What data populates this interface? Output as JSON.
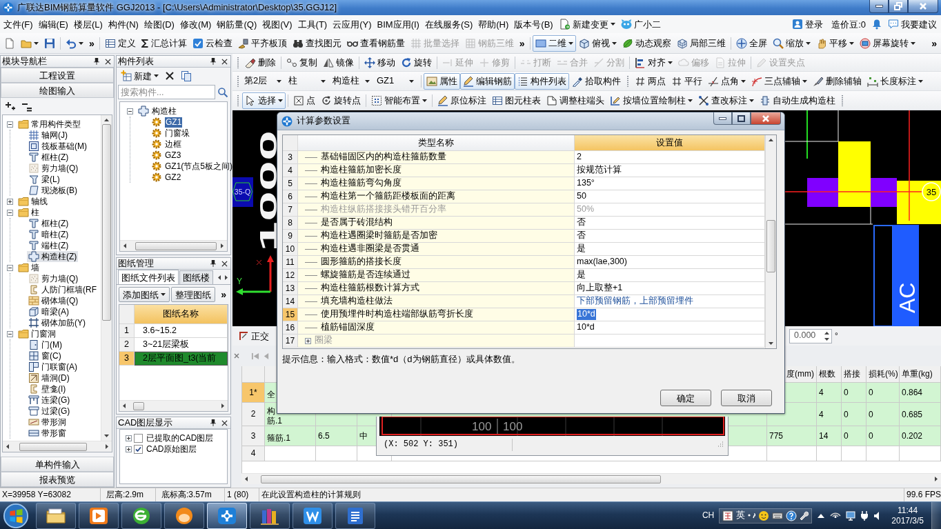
{
  "window": {
    "title": "广联达BIM钢筋算量软件 GGJ2013 - [C:\\Users\\Administrator\\Desktop\\35.GGJ12]"
  },
  "menu_bar": {
    "items": [
      "文件(F)",
      "编辑(E)",
      "楼层(L)",
      "构件(N)",
      "绘图(D)",
      "修改(M)",
      "钢筋量(Q)",
      "视图(V)",
      "工具(T)",
      "云应用(Y)",
      "BIM应用(I)",
      "在线服务(S)",
      "帮助(H)",
      "版本号(B)"
    ],
    "extras": [
      {
        "label": "新建变更",
        "dropdown": true
      },
      {
        "label": "广小二",
        "dropdown": false
      }
    ],
    "account": [
      "登录",
      "造价豆:0",
      "我要建议"
    ]
  },
  "main_toolbar": [
    {
      "kind": "button",
      "dropdown": false,
      "disabled": false,
      "on": false
    },
    {
      "kind": "button",
      "dropdown": true,
      "disabled": false,
      "on": false
    },
    {
      "kind": "button",
      "dropdown": false,
      "disabled": false,
      "on": false
    },
    {
      "kind": "separator"
    },
    {
      "kind": "button",
      "dropdown": true,
      "disabled": false,
      "on": false
    },
    {
      "kind": "overflow",
      "label": "»"
    },
    {
      "kind": "separator"
    },
    {
      "kind": "button",
      "label": "定义",
      "dropdown": false,
      "disabled": false,
      "on": false
    },
    {
      "kind": "button",
      "label": "汇总计算",
      "dropdown": false,
      "disabled": false,
      "on": false
    },
    {
      "kind": "button",
      "label": "云检查",
      "dropdown": false,
      "disabled": false,
      "on": false
    },
    {
      "kind": "button",
      "label": "平齐板顶",
      "dropdown": false,
      "disabled": false,
      "on": false
    },
    {
      "kind": "button",
      "label": "查找图元",
      "dropdown": false,
      "disabled": false,
      "on": false
    },
    {
      "kind": "button",
      "label": "查看钢筋量",
      "dropdown": false,
      "disabled": false,
      "on": false
    },
    {
      "kind": "button",
      "label": "批量选择",
      "dropdown": false,
      "disabled": true,
      "on": false
    },
    {
      "kind": "button",
      "label": "钢筋三维",
      "dropdown": false,
      "disabled": true,
      "on": false
    },
    {
      "kind": "overflow",
      "label": "»"
    },
    {
      "kind": "separator"
    },
    {
      "kind": "button",
      "label": "二维",
      "dropdown": true,
      "disabled": false,
      "on": true
    },
    {
      "kind": "button",
      "label": "俯视",
      "dropdown": true,
      "disabled": false,
      "on": false
    },
    {
      "kind": "button",
      "label": "动态观察",
      "dropdown": false,
      "disabled": false,
      "on": false
    },
    {
      "kind": "button",
      "label": "局部三维",
      "dropdown": false,
      "disabled": false,
      "on": false
    },
    {
      "kind": "separator"
    },
    {
      "kind": "button",
      "label": "全屏",
      "dropdown": false,
      "disabled": false,
      "on": false
    },
    {
      "kind": "button",
      "label": "缩放",
      "dropdown": true,
      "disabled": false,
      "on": false
    },
    {
      "kind": "button",
      "label": "平移",
      "dropdown": true,
      "disabled": false,
      "on": false
    },
    {
      "kind": "button",
      "label": "屏幕旋转",
      "dropdown": true,
      "disabled": false,
      "on": false
    },
    {
      "kind": "overflow",
      "label": "»"
    }
  ],
  "nav_panel": {
    "title": "模块导航栏",
    "sections_top": [
      "工程设置",
      "绘图输入"
    ],
    "tree": [
      {
        "label": "常用构件类型",
        "expanded": true,
        "selected": false,
        "children": [
          {
            "label": "轴网(J)",
            "selected": false
          },
          {
            "label": "筏板基础(M)",
            "selected": false
          },
          {
            "label": "框柱(Z)",
            "selected": false
          },
          {
            "label": "剪力墙(Q)",
            "selected": false
          },
          {
            "label": "梁(L)",
            "selected": false
          },
          {
            "label": "现浇板(B)",
            "selected": false
          }
        ]
      },
      {
        "label": "轴线",
        "expanded": false,
        "selected": false
      },
      {
        "label": "柱",
        "expanded": true,
        "selected": false,
        "children": [
          {
            "label": "框柱(Z)",
            "selected": false
          },
          {
            "label": "暗柱(Z)",
            "selected": false
          },
          {
            "label": "端柱(Z)",
            "selected": false
          },
          {
            "label": "构造柱(Z)",
            "selected": true
          }
        ]
      },
      {
        "label": "墙",
        "expanded": true,
        "selected": false,
        "children": [
          {
            "label": "剪力墙(Q)",
            "selected": false
          },
          {
            "label": "人防门框墙(RF",
            "selected": false
          },
          {
            "label": "砌体墙(Q)",
            "selected": false
          },
          {
            "label": "暗梁(A)",
            "selected": false
          },
          {
            "label": "砌体加筋(Y)",
            "selected": false
          }
        ]
      },
      {
        "label": "门窗洞",
        "expanded": true,
        "selected": false,
        "children": [
          {
            "label": "门(M)",
            "selected": false
          },
          {
            "label": "窗(C)",
            "selected": false
          },
          {
            "label": "门联窗(A)",
            "selected": false
          },
          {
            "label": "墙洞(D)",
            "selected": false
          },
          {
            "label": "壁龛(I)",
            "selected": false
          },
          {
            "label": "连梁(G)",
            "selected": false
          },
          {
            "label": "过梁(G)",
            "selected": false
          },
          {
            "label": "带形洞",
            "selected": false
          },
          {
            "label": "带形窗",
            "selected": false
          }
        ]
      }
    ],
    "sections_bottom": [
      "单构件输入",
      "报表预览"
    ]
  },
  "component_list": {
    "title": "构件列表",
    "toolbar": [
      {
        "kind": "button",
        "label": "新建",
        "dropdown": true,
        "disabled": false,
        "on": false
      },
      {
        "kind": "button",
        "dropdown": false,
        "disabled": false,
        "on": false
      },
      {
        "kind": "button",
        "dropdown": false,
        "disabled": false,
        "on": false
      }
    ],
    "search": {
      "placeholder": "搜索构件..."
    },
    "tree": [
      {
        "label": "构造柱",
        "expanded": true,
        "selected": false,
        "children": [
          {
            "label": "GZ1",
            "selected": true
          },
          {
            "label": "门窗垛",
            "selected": false
          },
          {
            "label": "边框",
            "selected": false
          },
          {
            "label": "GZ3",
            "selected": false
          },
          {
            "label": "GZ1(节点5板之间)",
            "selected": false
          },
          {
            "label": "GZ2",
            "selected": false
          }
        ]
      }
    ]
  },
  "drawing_panel": {
    "title": "图纸管理",
    "tabs": [
      {
        "label": "图纸文件列表",
        "selected": true
      },
      {
        "label": "图纸楼",
        "selected": false
      }
    ],
    "toolbar": [
      {
        "kind": "button",
        "label": "添加图纸",
        "dropdown": true,
        "disabled": false,
        "on": false
      },
      {
        "kind": "button",
        "label": "整理图纸",
        "dropdown": false,
        "disabled": false,
        "on": false
      },
      {
        "kind": "overflow",
        "label": "»"
      }
    ],
    "table": {
      "columns": [
        "图纸名称"
      ],
      "rows": [
        {
          "no": "1",
          "name": "3.6~15.2",
          "selected": false
        },
        {
          "no": "2",
          "name": "3~21层梁板",
          "selected": false
        },
        {
          "no": "3",
          "name": "2层平面图_t3(当前",
          "selected": true
        }
      ]
    }
  },
  "cad_layers": {
    "title": "CAD图层显示",
    "items": [
      {
        "label": "已提取的CAD图层",
        "expanded": false,
        "checked": false
      },
      {
        "label": "CAD原始图层",
        "expanded": false,
        "checked": true
      }
    ]
  },
  "edit_toolbar": [
    {
      "kind": "grip"
    },
    {
      "kind": "button",
      "label": "删除",
      "dropdown": false,
      "disabled": false,
      "on": false
    },
    {
      "kind": "separator"
    },
    {
      "kind": "button",
      "label": "复制",
      "dropdown": false,
      "disabled": false,
      "on": false
    },
    {
      "kind": "button",
      "label": "镜像",
      "dropdown": false,
      "disabled": false,
      "on": false
    },
    {
      "kind": "separator"
    },
    {
      "kind": "button",
      "label": "移动",
      "dropdown": false,
      "disabled": false,
      "on": false
    },
    {
      "kind": "button",
      "label": "旋转",
      "dropdown": false,
      "disabled": false,
      "on": false
    },
    {
      "kind": "separator"
    },
    {
      "kind": "button",
      "label": "延伸",
      "dropdown": false,
      "disabled": true,
      "on": false
    },
    {
      "kind": "button",
      "label": "修剪",
      "dropdown": false,
      "disabled": true,
      "on": false
    },
    {
      "kind": "separator"
    },
    {
      "kind": "button",
      "label": "打断",
      "dropdown": false,
      "disabled": true,
      "on": false
    },
    {
      "kind": "button",
      "label": "合并",
      "dropdown": false,
      "disabled": true,
      "on": false
    },
    {
      "kind": "button",
      "label": "分割",
      "dropdown": false,
      "disabled": true,
      "on": false
    },
    {
      "kind": "separator"
    },
    {
      "kind": "button",
      "label": "对齐",
      "dropdown": true,
      "disabled": false,
      "on": false
    },
    {
      "kind": "button",
      "label": "偏移",
      "dropdown": false,
      "disabled": true,
      "on": false
    },
    {
      "kind": "button",
      "label": "拉伸",
      "dropdown": false,
      "disabled": true,
      "on": false
    },
    {
      "kind": "separator"
    },
    {
      "kind": "button",
      "label": "设置夹点",
      "dropdown": false,
      "disabled": true,
      "on": false
    }
  ],
  "component_toolbar": [
    {
      "kind": "grip"
    },
    {
      "kind": "combo",
      "value": "第2层"
    },
    {
      "kind": "combo",
      "value": "柱"
    },
    {
      "kind": "combo",
      "value": "构造柱"
    },
    {
      "kind": "combo",
      "value": "GZ1"
    },
    {
      "kind": "separator"
    },
    {
      "kind": "button",
      "label": "属性",
      "dropdown": false,
      "disabled": false,
      "on": true
    },
    {
      "kind": "button",
      "label": "编辑钢筋",
      "dropdown": false,
      "disabled": false,
      "on": true
    },
    {
      "kind": "button",
      "label": "构件列表",
      "dropdown": false,
      "disabled": false,
      "on": true
    },
    {
      "kind": "button",
      "label": "拾取构件",
      "dropdown": false,
      "disabled": false,
      "on": false
    },
    {
      "kind": "grip"
    },
    {
      "kind": "button",
      "label": "两点",
      "dropdown": false,
      "disabled": false,
      "on": false
    },
    {
      "kind": "button",
      "label": "平行",
      "dropdown": false,
      "disabled": false,
      "on": false
    },
    {
      "kind": "button",
      "label": "点角",
      "dropdown": true,
      "disabled": false,
      "on": false
    },
    {
      "kind": "button",
      "label": "三点辅轴",
      "dropdown": true,
      "disabled": false,
      "on": false
    },
    {
      "kind": "button",
      "label": "删除辅轴",
      "dropdown": false,
      "disabled": false,
      "on": false
    },
    {
      "kind": "button",
      "label": "长度标注",
      "dropdown": true,
      "disabled": false,
      "on": false
    }
  ],
  "draw_toolbar": [
    {
      "kind": "grip"
    },
    {
      "kind": "button",
      "label": "选择",
      "dropdown": true,
      "disabled": false,
      "on": true
    },
    {
      "kind": "separator"
    },
    {
      "kind": "button",
      "label": "点",
      "dropdown": false,
      "disabled": false,
      "on": false
    },
    {
      "kind": "button",
      "label": "旋转点",
      "dropdown": false,
      "disabled": false,
      "on": false
    },
    {
      "kind": "separator"
    },
    {
      "kind": "button",
      "label": "智能布置",
      "dropdown": true,
      "disabled": false,
      "on": false
    },
    {
      "kind": "separator"
    },
    {
      "kind": "button",
      "label": "原位标注",
      "dropdown": false,
      "disabled": false,
      "on": false
    },
    {
      "kind": "button",
      "label": "图元柱表",
      "dropdown": false,
      "disabled": false,
      "on": false
    },
    {
      "kind": "button",
      "label": "调整柱端头",
      "dropdown": false,
      "disabled": false,
      "on": false
    },
    {
      "kind": "button",
      "label": "按墙位置绘制柱",
      "dropdown": true,
      "disabled": false,
      "on": false
    },
    {
      "kind": "button",
      "label": "查改标注",
      "dropdown": true,
      "disabled": false,
      "on": false
    },
    {
      "kind": "button",
      "label": "自动生成构造柱",
      "dropdown": false,
      "disabled": false,
      "on": false
    },
    {
      "kind": "grip"
    }
  ],
  "canvas": {
    "dimension_text": "1000",
    "axis_labels": [
      "35-Q",
      "35"
    ],
    "ucs_label": "Y",
    "column_label": "AC"
  },
  "ortho_bar": {
    "toggle": {
      "label": "正交",
      "on": false
    },
    "angle": {
      "value": "0.000",
      "unit": "°"
    }
  },
  "rebar_table": {
    "columns": [
      "度(mm)",
      "根数",
      "搭接",
      "损耗(%)",
      "单重(kg)"
    ],
    "rows": [
      {
        "no": "1*",
        "kind": "data",
        "selected": true,
        "name": [
          "全"
        ],
        "count": "4",
        "lap": "0",
        "loss": "0",
        "weight": "0.864"
      },
      {
        "no": "2",
        "kind": "data",
        "selected": false,
        "name": [
          "构",
          "筋.1"
        ],
        "count": "4",
        "lap": "0",
        "loss": "0",
        "weight": "0.685"
      },
      {
        "no": "3",
        "kind": "data",
        "selected": false,
        "name": [
          "箍筋.1"
        ],
        "diameter": "6.5",
        "grade": "中",
        "length": "775",
        "count": "14",
        "lap": "0",
        "loss": "0",
        "weight": "0.202"
      },
      {
        "no": "4",
        "kind": "empty",
        "selected": false
      }
    ]
  },
  "preview_window": {
    "dimension_texts": [
      "100",
      "100"
    ],
    "coordinates": "(X: 502 Y: 351)"
  },
  "dialog": {
    "title": "计算参数设置",
    "columns": [
      "类型名称",
      "设置值"
    ],
    "rows": [
      {
        "no": "3",
        "kind": "param",
        "name": "基础锚固区内的构造柱箍筋数量",
        "value": "2",
        "disabled": false,
        "modified": false,
        "selected": false
      },
      {
        "no": "4",
        "kind": "param",
        "name": "构造柱箍筋加密长度",
        "value": "按规范计算",
        "disabled": false,
        "modified": false,
        "selected": false
      },
      {
        "no": "5",
        "kind": "param",
        "name": "构造柱箍筋弯勾角度",
        "value": "135°",
        "disabled": false,
        "modified": false,
        "selected": false
      },
      {
        "no": "6",
        "kind": "param",
        "name": "构造柱第一个箍筋距楼板面的距离",
        "value": "50",
        "disabled": false,
        "modified": false,
        "selected": false
      },
      {
        "no": "7",
        "kind": "param",
        "name": "构造柱纵筋搭接接头错开百分率",
        "value": "50%",
        "disabled": true,
        "modified": false,
        "selected": false
      },
      {
        "no": "8",
        "kind": "param",
        "name": "是否属于砖混结构",
        "value": "否",
        "disabled": false,
        "modified": false,
        "selected": false
      },
      {
        "no": "9",
        "kind": "param",
        "name": "构造柱遇圈梁时箍筋是否加密",
        "value": "否",
        "disabled": false,
        "modified": false,
        "selected": false
      },
      {
        "no": "10",
        "kind": "param",
        "name": "构造柱遇非圈梁是否贯通",
        "value": "是",
        "disabled": false,
        "modified": false,
        "selected": false
      },
      {
        "no": "11",
        "kind": "param",
        "name": "圆形箍筋的搭接长度",
        "value": "max(lae,300)",
        "disabled": false,
        "modified": false,
        "selected": false
      },
      {
        "no": "12",
        "kind": "param",
        "name": "螺旋箍筋是否连续通过",
        "value": "是",
        "disabled": false,
        "modified": false,
        "selected": false
      },
      {
        "no": "13",
        "kind": "param",
        "name": "构造柱箍筋根数计算方式",
        "value": "向上取整+1",
        "disabled": false,
        "modified": false,
        "selected": false
      },
      {
        "no": "14",
        "kind": "param",
        "name": "填充墙构造柱做法",
        "value": "下部预留钢筋，上部预留埋件",
        "disabled": false,
        "modified": true,
        "selected": false
      },
      {
        "no": "15",
        "kind": "param",
        "name": "使用预埋件时构造柱端部纵筋弯折长度",
        "value": "10*d",
        "disabled": false,
        "modified": false,
        "selected": true
      },
      {
        "no": "16",
        "kind": "param",
        "name": "植筋锚固深度",
        "value": "10*d",
        "disabled": false,
        "modified": false,
        "selected": false
      },
      {
        "no": "17",
        "kind": "group",
        "name": "圈梁",
        "expanded": false,
        "disabled": true,
        "selected": false
      }
    ],
    "hint": "提示信息：输入格式：数值*d（d为钢筋直径）或具体数值。",
    "buttons": [
      "确定",
      "取消"
    ]
  },
  "status_bar": [
    "X=39958 Y=63082",
    "层高:2.9m",
    "底标高:3.57m",
    "1 (80)",
    "在此设置构造柱的计算规则",
    "99.6 FPS"
  ],
  "taskbar": {
    "apps": [
      {
        "active": false
      },
      {
        "active": false
      },
      {
        "active": false
      },
      {
        "active": false
      },
      {
        "active": true
      },
      {
        "active": false
      },
      {
        "active": false
      },
      {
        "active": false
      }
    ],
    "language": "CH",
    "ime_mode": "英",
    "time": "11:44",
    "date": "2017/3/5"
  }
}
